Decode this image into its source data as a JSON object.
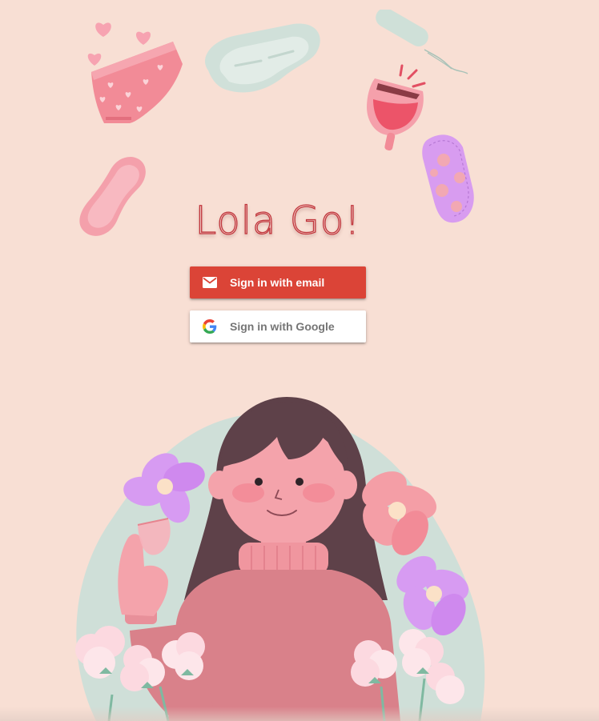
{
  "app": {
    "title": "Lola Go!"
  },
  "auth": {
    "email_button": {
      "label": "Sign in with email",
      "icon": "mail-icon",
      "background": "#db4437"
    },
    "google_button": {
      "label": "Sign in with Google",
      "icon": "google-logo-icon",
      "background": "#ffffff"
    }
  },
  "illustrations": [
    "hearts-icon",
    "period-underwear-icon",
    "sanitary-pad-icon",
    "tampon-icon",
    "menstrual-cup-icon",
    "panty-liner-icon",
    "cloth-pad-icon",
    "girl-holding-cup-illustration"
  ],
  "colors": {
    "background": "#f8dfd4",
    "title_stroke": "#c1373d",
    "accent_pink": "#f28b97",
    "sweater": "#d9818a",
    "hair": "#5e4149"
  }
}
